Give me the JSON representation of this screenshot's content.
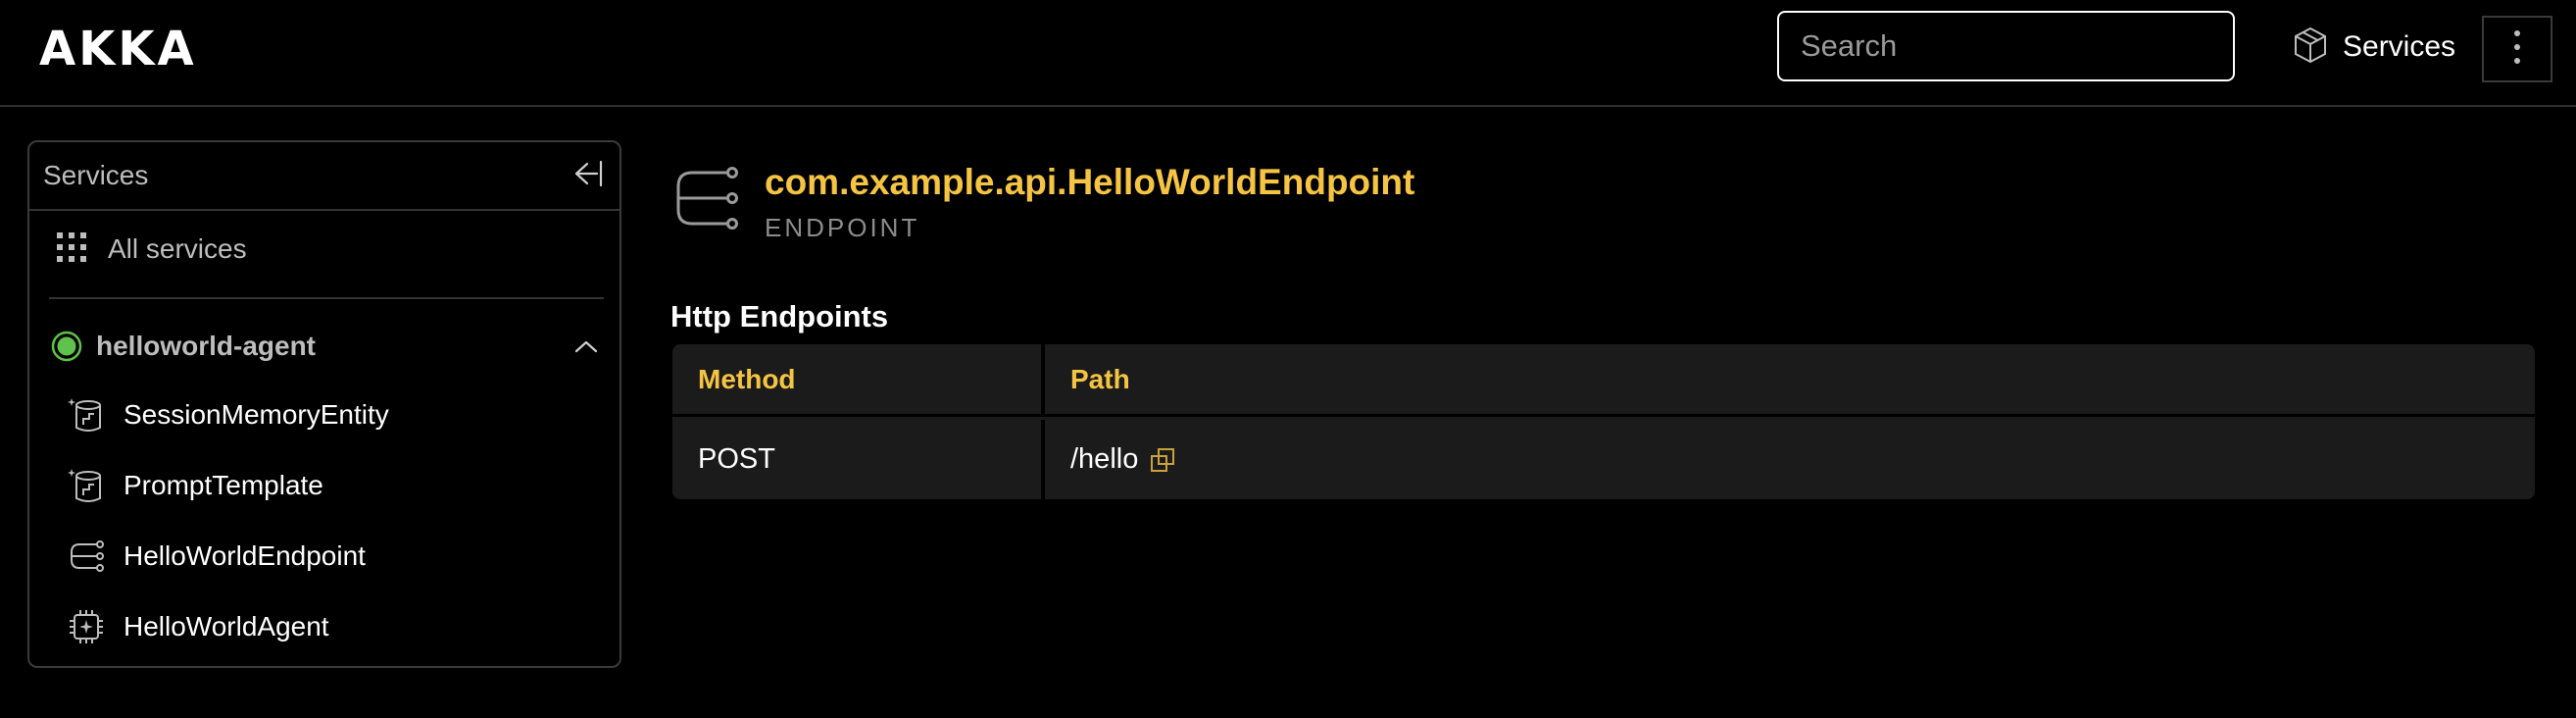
{
  "header": {
    "logo": "AKKA",
    "search_placeholder": "Search",
    "services_label": "Services",
    "services_icon": "cube-icon",
    "menu_icon": "kebab-menu-icon"
  },
  "sidebar": {
    "title": "Services",
    "collapse_icon": "collapse-left-icon",
    "all_services_label": "All services",
    "all_services_icon": "grid-icon",
    "group": {
      "label": "helloworld-agent",
      "status_color": "#5fc24a",
      "expanded": true
    },
    "items": [
      {
        "label": "SessionMemoryEntity",
        "icon": "entity-icon"
      },
      {
        "label": "PromptTemplate",
        "icon": "entity-icon"
      },
      {
        "label": "HelloWorldEndpoint",
        "icon": "endpoint-icon"
      },
      {
        "label": "HelloWorldAgent",
        "icon": "agent-chip-icon"
      }
    ]
  },
  "main": {
    "title": "com.example.api.HelloWorldEndpoint",
    "subtitle": "ENDPOINT",
    "section_heading": "Http Endpoints",
    "table": {
      "columns": [
        "Method",
        "Path"
      ],
      "rows": [
        {
          "method": "POST",
          "path": "/hello"
        }
      ]
    }
  },
  "colors": {
    "accent": "#f5c443",
    "background": "#000000",
    "panel": "#1b1b1b",
    "status_ok": "#5fc24a"
  }
}
